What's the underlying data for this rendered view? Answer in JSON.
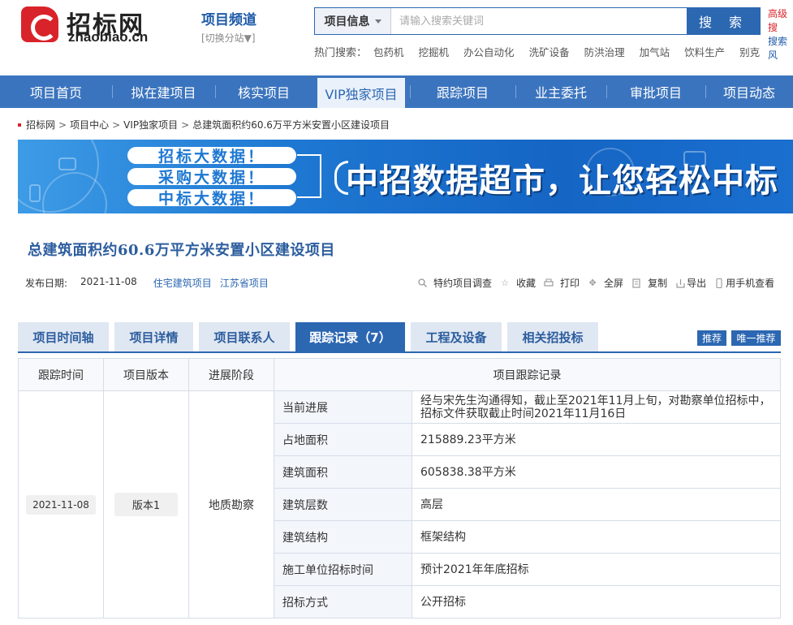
{
  "site": {
    "logo_cn": "招标网",
    "logo_en": "zhaobiao.cn",
    "channel_title": "项目频道",
    "channel_switch": "[切换分站▼]"
  },
  "search": {
    "category": "项目信息",
    "placeholder": "请输入搜索关键词",
    "button": "搜 索",
    "advanced": "高级搜",
    "advanced2": "搜索风"
  },
  "hot_search": {
    "label": "热门搜索：",
    "items": [
      "包药机",
      "挖掘机",
      "办公自动化",
      "洗矿设备",
      "防洪治理",
      "加气站",
      "饮料生产",
      "别克"
    ]
  },
  "nav": {
    "items": [
      "项目首页",
      "拟在建项目",
      "核实项目",
      "VIP独家项目",
      "跟踪项目",
      "业主委托",
      "审批项目",
      "项目动态"
    ],
    "active_index": 3
  },
  "breadcrumb": {
    "items": [
      "招标网",
      "项目中心",
      "VIP独家项目",
      "总建筑面积约60.6万平方米安置小区建设项目"
    ],
    "separator": ">"
  },
  "banner": {
    "pills": [
      "招标大数据！",
      "采购大数据！",
      "中标大数据！"
    ],
    "headline": "中招数据超市，让您轻松中标"
  },
  "project": {
    "title": "总建筑面积约60.6万平方米安置小区建设项目",
    "date_label": "发布日期:",
    "date": "2021-11-08",
    "tags": [
      "住宅建筑项目",
      "江苏省项目"
    ]
  },
  "tools": [
    "特约项目调查",
    "收藏",
    "打印",
    "全屏",
    "复制",
    "导出",
    "用手机查看"
  ],
  "tabs": {
    "items": [
      "项目时间轴",
      "项目详情",
      "项目联系人",
      "跟踪记录（7）",
      "工程及设备",
      "相关招投标"
    ],
    "active_index": 3,
    "recommend": "推荐",
    "unique_recommend": "唯一推荐"
  },
  "tracking_table": {
    "headers": [
      "跟踪时间",
      "项目版本",
      "进展阶段",
      "项目跟踪记录"
    ],
    "time": "2021-11-08",
    "version": "版本1",
    "stage": "地质勘察",
    "rows": [
      {
        "label": "当前进展",
        "value": "经与宋先生沟通得知，截止至2021年11月上旬，对勘察单位招标中，招标文件获取截止时间2021年11月16日"
      },
      {
        "label": "占地面积",
        "value": "215889.23平方米"
      },
      {
        "label": "建筑面积",
        "value": "605838.38平方米"
      },
      {
        "label": "建筑层数",
        "value": "高层"
      },
      {
        "label": "建筑结构",
        "value": "框架结构"
      },
      {
        "label": "施工单位招标时间",
        "value": "预计2021年年底招标"
      },
      {
        "label": "招标方式",
        "value": "公开招标"
      }
    ]
  },
  "colors": {
    "primary": "#2c67b2",
    "nav_bg": "#3b74be",
    "brand_red": "#d9232a"
  }
}
